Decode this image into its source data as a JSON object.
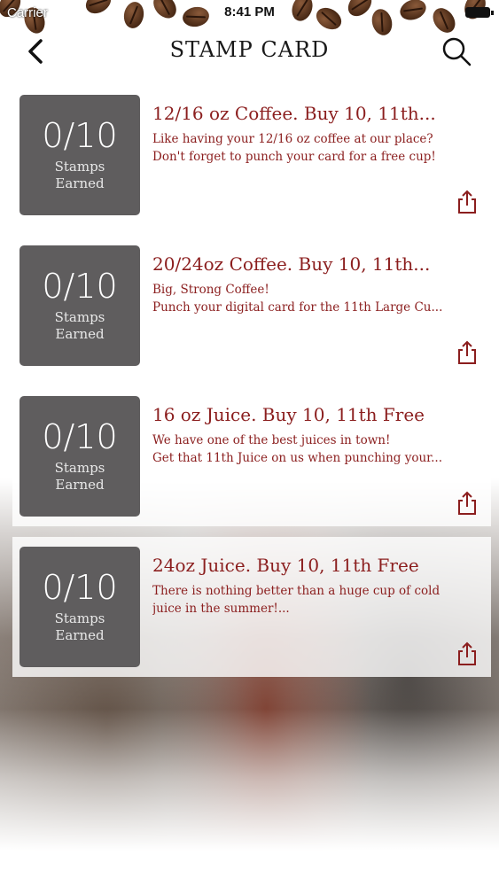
{
  "status_bar": {
    "carrier": "Carrier",
    "time": "8:41 PM"
  },
  "nav": {
    "title": "STAMP CARD",
    "back_icon": "chevron-left-icon",
    "search_icon": "search-icon"
  },
  "colors": {
    "accent": "#8b1e1e",
    "stamp_box": "#5f5d5e"
  },
  "cards": [
    {
      "stamp_count": "0/10",
      "stamp_label_1": "Stamps",
      "stamp_label_2": "Earned",
      "title": "12/16 oz Coffee. Buy 10, 11th...",
      "desc_line_1": "Like having your 12/16 oz coffee at our place?",
      "desc_line_2": "Don't forget to punch your card for a free cup!"
    },
    {
      "stamp_count": "0/10",
      "stamp_label_1": "Stamps",
      "stamp_label_2": "Earned",
      "title": "20/24oz Coffee. Buy 10, 11th...",
      "desc_line_1": "Big, Strong Coffee!",
      "desc_line_2": "Punch your digital card for the 11th Large Cu..."
    },
    {
      "stamp_count": "0/10",
      "stamp_label_1": "Stamps",
      "stamp_label_2": "Earned",
      "title": "16 oz Juice. Buy 10, 11th Free",
      "desc_line_1": "We have one of the best juices in town!",
      "desc_line_2": "Get that 11th Juice on us when punching your..."
    },
    {
      "stamp_count": "0/10",
      "stamp_label_1": "Stamps",
      "stamp_label_2": "Earned",
      "title": "24oz Juice. Buy 10, 11th Free",
      "desc_line_1": "There is nothing better than a huge cup of cold",
      "desc_line_2": "juice in the summer!..."
    }
  ]
}
